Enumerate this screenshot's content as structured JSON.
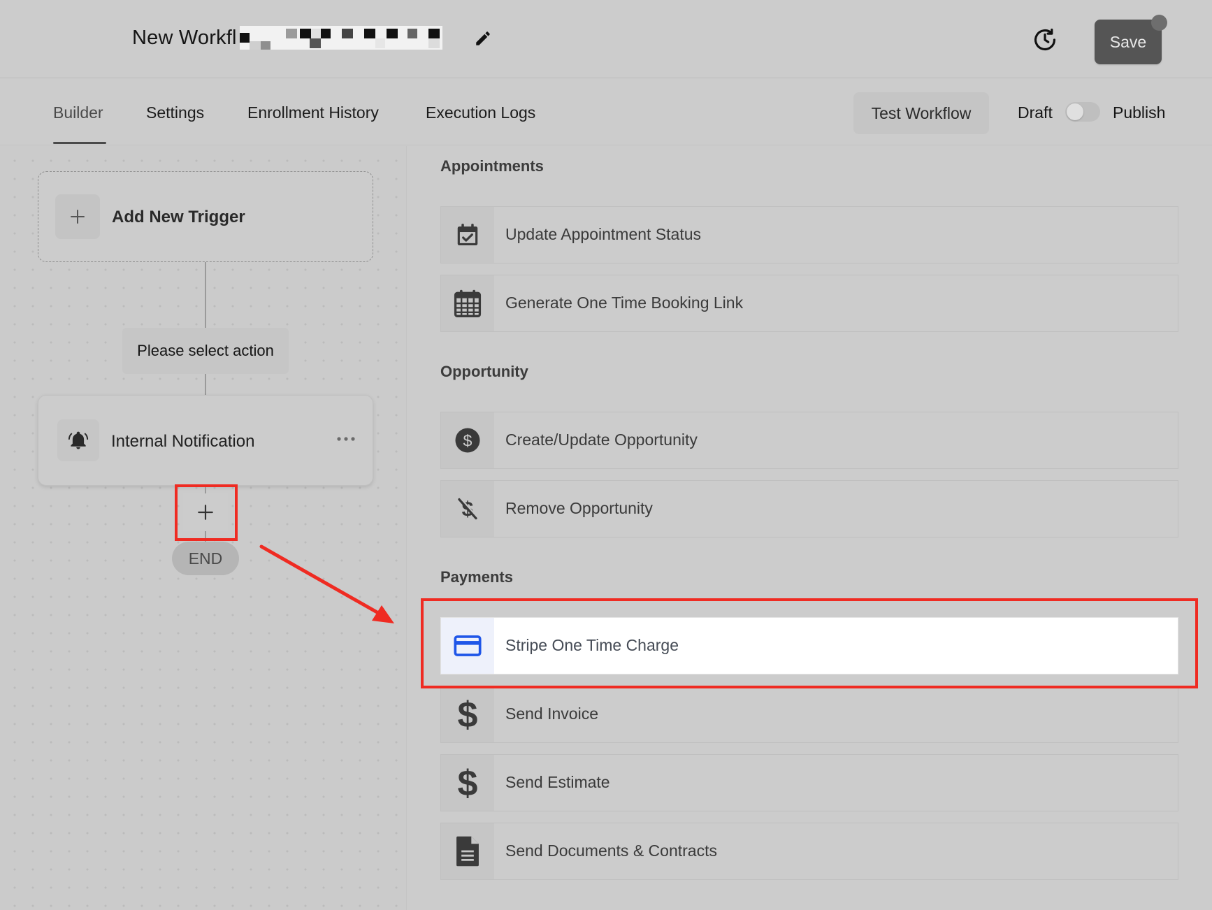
{
  "header": {
    "title": "New Workfl",
    "edit_icon": "pencil-icon",
    "history_icon": "history-icon",
    "save_label": "Save"
  },
  "tabs": [
    {
      "label": "Builder",
      "active": true
    },
    {
      "label": "Settings",
      "active": false
    },
    {
      "label": "Enrollment History",
      "active": false
    },
    {
      "label": "Execution Logs",
      "active": false
    }
  ],
  "toolbar": {
    "test_label": "Test Workflow",
    "draft_label": "Draft",
    "publish_label": "Publish",
    "published": false
  },
  "canvas": {
    "trigger_label": "Add New Trigger",
    "select_action_label": "Please select action",
    "action_node_label": "Internal Notification",
    "end_label": "END"
  },
  "sections": [
    {
      "title": "Appointments",
      "items": [
        {
          "label": "Update Appointment Status",
          "icon": "calendar-check-icon"
        },
        {
          "label": "Generate One Time Booking Link",
          "icon": "calendar-grid-icon"
        }
      ]
    },
    {
      "title": "Opportunity",
      "items": [
        {
          "label": "Create/Update Opportunity",
          "icon": "dollar-circle-icon"
        },
        {
          "label": "Remove Opportunity",
          "icon": "dollar-off-icon"
        }
      ]
    },
    {
      "title": "Payments",
      "items": [
        {
          "label": "Stripe One Time Charge",
          "icon": "credit-card-icon",
          "highlighted": true
        },
        {
          "label": "Send Invoice",
          "icon": "dollar-sign-icon"
        },
        {
          "label": "Send Estimate",
          "icon": "dollar-sign-icon"
        },
        {
          "label": "Send Documents & Contracts",
          "icon": "document-icon"
        }
      ]
    }
  ],
  "colors": {
    "highlight": "#ef2b22",
    "card_icon_blue": "#1f56e8",
    "save_bg": "#555555"
  }
}
